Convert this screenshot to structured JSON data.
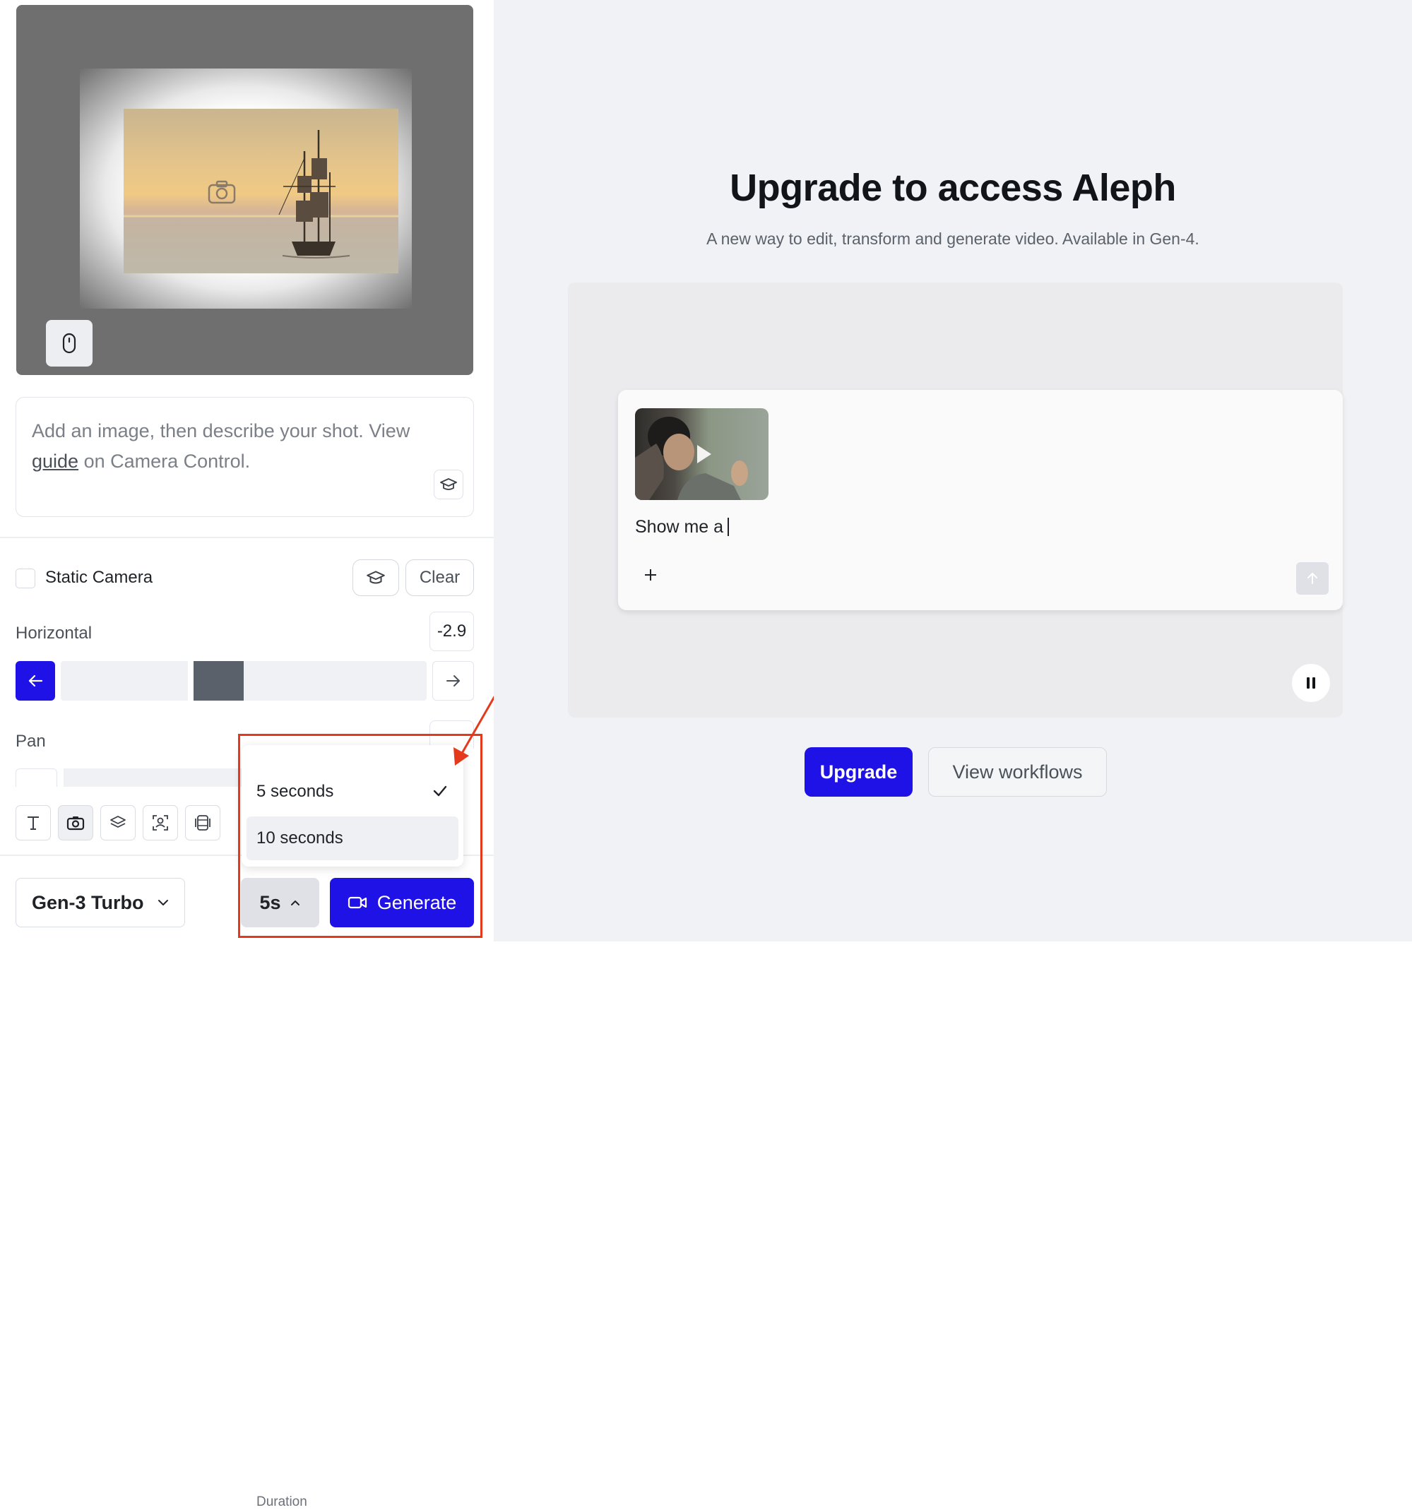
{
  "prompt": {
    "text_before": "Add an image, then describe your shot. View ",
    "guide_link": "guide",
    "text_after": " on Camera Control."
  },
  "camera": {
    "static_camera_label": "Static Camera",
    "static_camera_checked": false,
    "clear_label": "Clear",
    "horizontal_label": "Horizontal",
    "horizontal_value": "-2.9",
    "horizontal_range": [
      -10,
      10
    ],
    "pan_label": "Pan"
  },
  "toolbar": {
    "icons": [
      "text-icon",
      "camera-icon",
      "layers-icon",
      "face-detect-icon",
      "frames-icon"
    ],
    "active_icon": "camera-icon"
  },
  "bottom_bar": {
    "model_label": "Gen-3 Turbo",
    "duration_label": "5s",
    "generate_label": "Generate"
  },
  "duration_menu": {
    "title": "Duration",
    "options": [
      {
        "label": "5 seconds",
        "selected": true
      },
      {
        "label": "10 seconds",
        "selected": false
      }
    ]
  },
  "upgrade": {
    "title": "Upgrade to access Aleph",
    "subtitle": "A new way to edit, transform and generate video. Available in Gen-4.",
    "demo_prompt": "Show me a",
    "upgrade_label": "Upgrade",
    "view_workflows_label": "View workflows"
  },
  "colors": {
    "accent": "#1f12e6",
    "annotation": "#e5391b"
  }
}
